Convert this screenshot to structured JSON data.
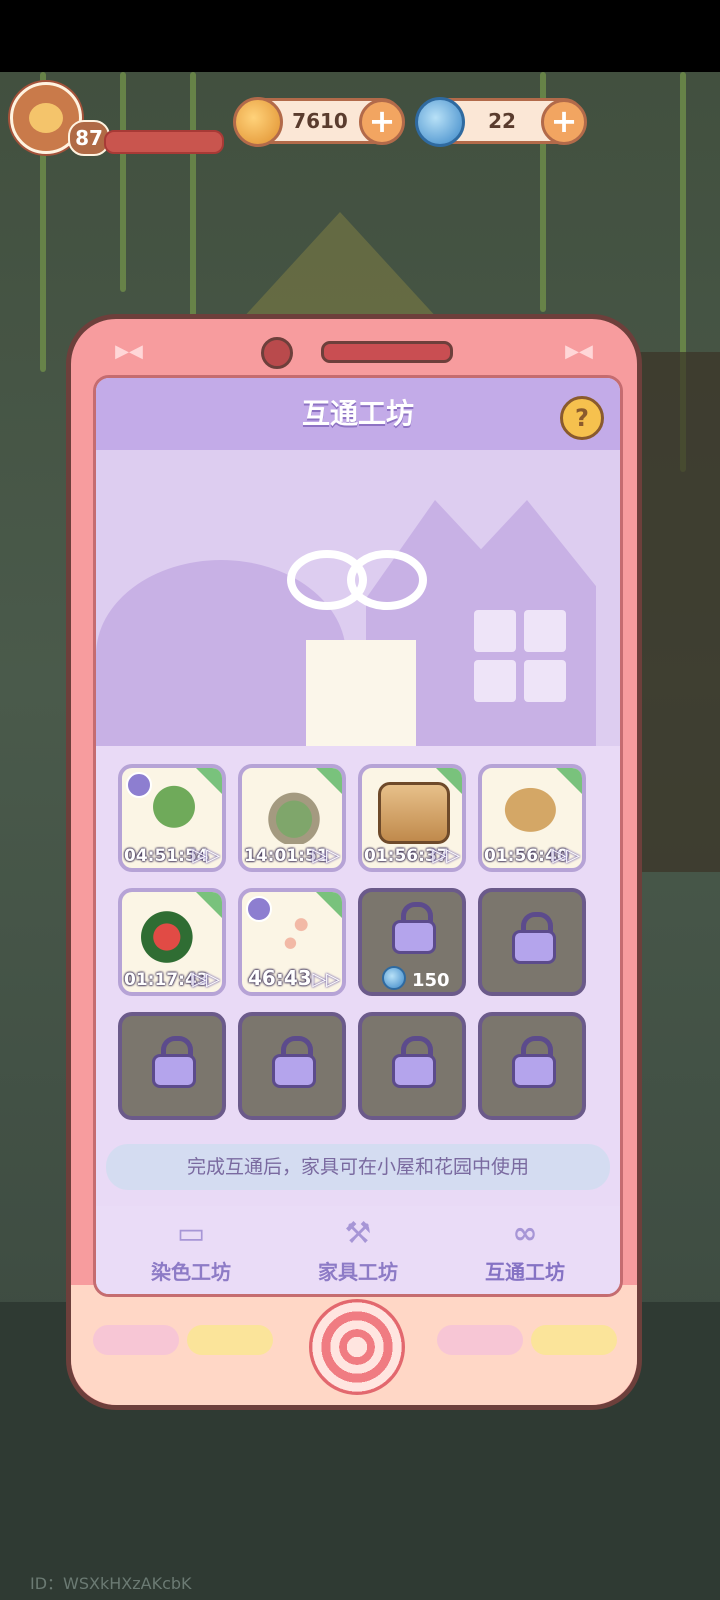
{
  "hud": {
    "level": "87",
    "coins": "7610",
    "spirals": "22",
    "plus": "+"
  },
  "screen": {
    "title": "互通工坊",
    "help": "?",
    "note": "完成互通后，家具可在小屋和花园中使用"
  },
  "slots": [
    {
      "timer": "04:51:54",
      "ff": "▷▷",
      "art": "tree"
    },
    {
      "timer": "14:01:51",
      "ff": "▷▷",
      "art": "pond"
    },
    {
      "timer": "01:56:37",
      "ff": "▷▷",
      "art": "chess-table"
    },
    {
      "timer": "01:56:40",
      "ff": "▷▷",
      "art": "fan"
    },
    {
      "timer": "01:17:43",
      "ff": "▷▷",
      "art": "watermelon"
    },
    {
      "timer": "46:43",
      "ff": "▷▷",
      "art": "butterflies"
    },
    {
      "cost": "150"
    }
  ],
  "tabs": [
    {
      "label": "染色工坊",
      "icon": "paint-roller-icon"
    },
    {
      "label": "家具工坊",
      "icon": "wrench-icon"
    },
    {
      "label": "互通工坊",
      "icon": "infinity-icon"
    }
  ],
  "watermark": "ID：WSXkHXzAKcbK"
}
